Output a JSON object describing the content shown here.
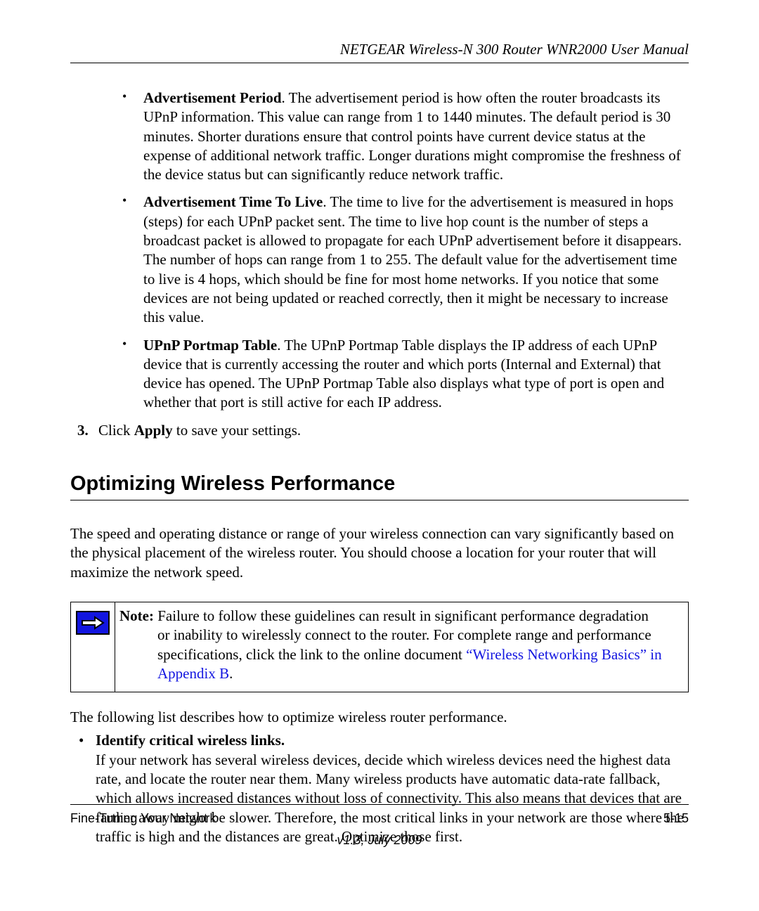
{
  "header": {
    "title": "NETGEAR Wireless-N 300 Router WNR2000 User Manual"
  },
  "bullets": {
    "b1": {
      "label": "Advertisement Period",
      "text": ". The advertisement period is how often the router broadcasts its UPnP information. This value can range from 1 to 1440 minutes. The default period is 30 minutes. Shorter durations ensure that control points have current device status at the expense of additional network traffic. Longer durations might compromise the freshness of the device status but can significantly reduce network traffic."
    },
    "b2": {
      "label": "Advertisement Time To Live",
      "text": ". The time to live for the advertisement is measured in hops (steps) for each UPnP packet sent. The time to live hop count is the number of steps a broadcast packet is allowed to propagate for each UPnP advertisement before it disappears. The number of hops can range from 1 to 255. The default value for the advertisement time to live is 4 hops, which should be fine for most home networks. If you notice that some devices are not being updated or reached correctly, then it might be necessary to increase this value."
    },
    "b3": {
      "label": "UPnP Portmap Table",
      "text": ". The UPnP Portmap Table displays the IP address of each UPnP device that is currently accessing the router and which ports (Internal and External) that device has opened. The UPnP Portmap Table also displays what type of port is open and whether that port is still active for each IP address."
    }
  },
  "step3": {
    "num": "3.",
    "pre": "Click ",
    "bold": "Apply",
    "post": " to save your settings."
  },
  "section_title": "Optimizing Wireless Performance",
  "intro": "The speed and operating distance or range of your wireless connection can vary significantly based on the physical placement of the wireless router. You should choose a location for your router that will maximize the network speed.",
  "note": {
    "label": "Note:",
    "line1": " Failure to follow these guidelines can result in significant performance degradation",
    "line2": "or inability to wirelessly connect to the router. For complete range and performance specifications, click the link to the online document ",
    "link": "“Wireless Networking Basics” in Appendix B",
    "tail": "."
  },
  "para2": "The following list describes how to optimize wireless router performance.",
  "mb1": {
    "title": "Identify critical wireless links.",
    "body": "If your network has several wireless devices, decide which wireless devices need the highest data rate, and locate the router near them. Many wireless products have automatic data-rate fallback, which allows increased distances without loss of connectivity. This also means that devices that are farther away might be slower. Therefore, the most critical links in your network are those where the traffic is high and the distances are great. Optimize those first."
  },
  "footer": {
    "section": "Fine-Tuning Your Network",
    "page": "5-15",
    "version": "v1.3, July 2009"
  }
}
